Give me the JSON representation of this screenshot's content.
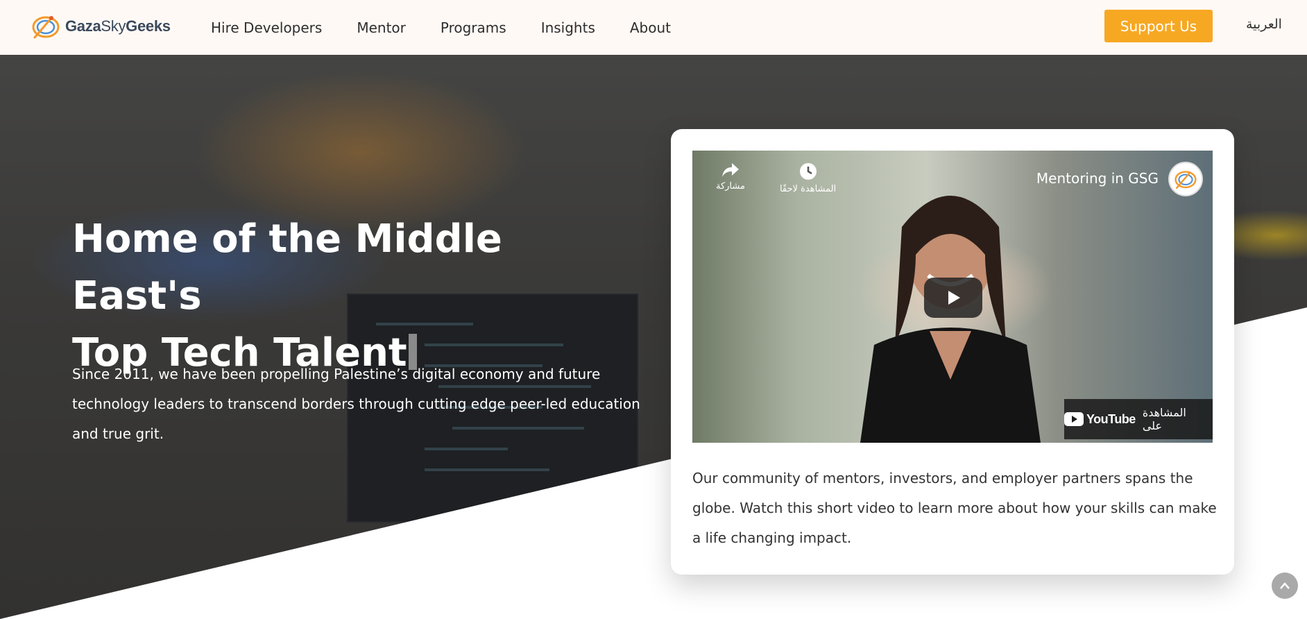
{
  "navbar": {
    "logo": {
      "part1": "Gaza",
      "part2": "Sky",
      "part3": "Geeks"
    },
    "links": [
      {
        "label": "Hire Developers"
      },
      {
        "label": "Mentor"
      },
      {
        "label": "Programs"
      },
      {
        "label": "Insights"
      },
      {
        "label": "About"
      }
    ],
    "support_label": "Support Us",
    "language_label": "العربية"
  },
  "hero": {
    "title_line1": "Home of the Middle East's",
    "title_line2": "Top Tech Talent",
    "description": "Since 2011, we have been propelling Palestine’s digital economy and future technology leaders to transcend borders through cutting edge peer-led education and true grit."
  },
  "video_card": {
    "video": {
      "title": "Mentoring in GSG",
      "share_label": "مشاركة",
      "watch_later_label": "المشاهدة لاحقًا",
      "watch_on_label": "المشاهدة على",
      "youtube_label": "YouTube"
    },
    "text": "Our community of mentors, investors, and employer partners spans the globe. Watch this short video to learn more about how your skills can make a life changing impact."
  },
  "colors": {
    "accent": "#f7a823",
    "nav_bg": "#fff9f5",
    "text_dark": "#333333"
  },
  "icons": [
    "share-icon",
    "clock-icon",
    "play-icon",
    "youtube-icon",
    "chevron-up-icon"
  ]
}
